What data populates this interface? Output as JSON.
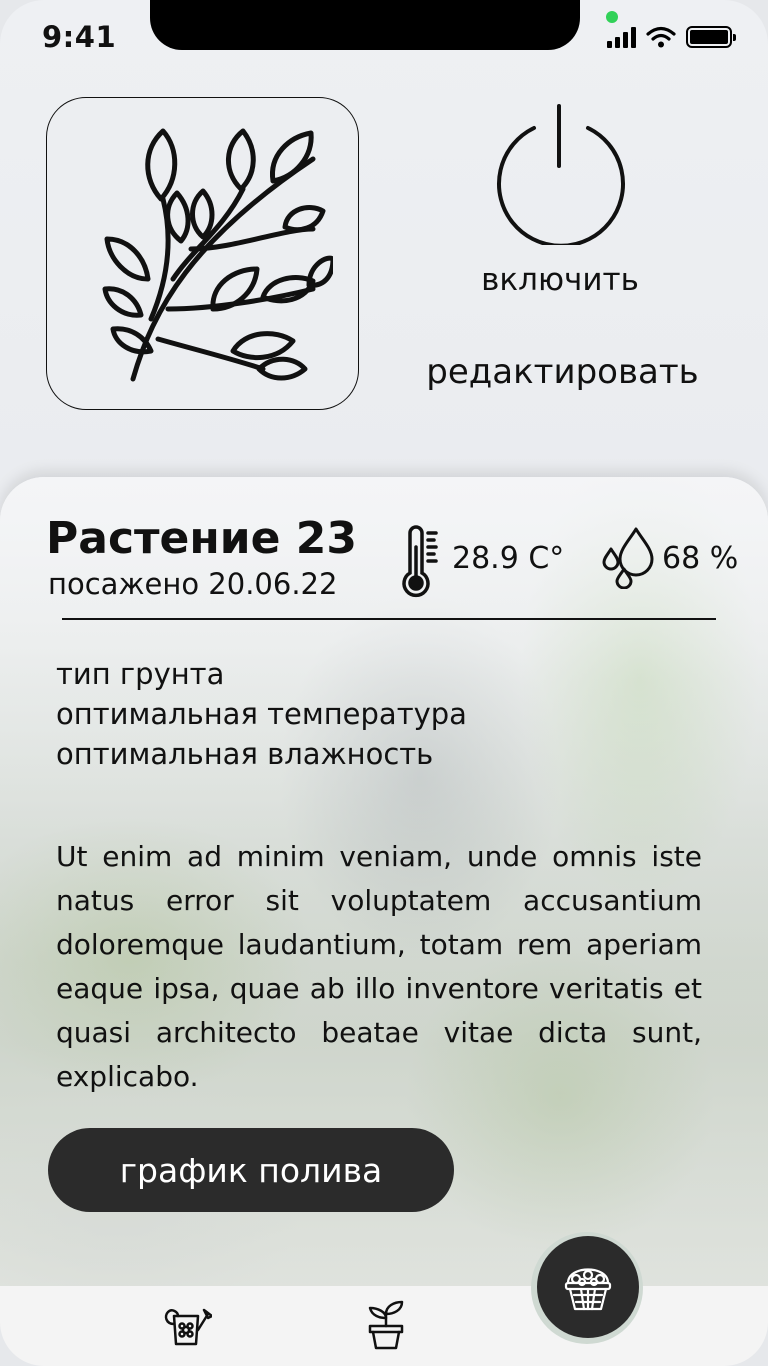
{
  "status_bar": {
    "time": "9:41"
  },
  "controls": {
    "power_label": "включить",
    "edit_label": "редактировать"
  },
  "plant": {
    "title": "Растение 23",
    "planted": "посажено 20.06.22",
    "temperature": "28.9 C°",
    "humidity": "68 %",
    "attributes": [
      "тип грунта",
      "оптимальная температура",
      "оптимальная влажность"
    ],
    "description": "Ut enim ad minim veniam, unde omnis iste natus error sit voluptatem accusantium doloremque laudantium, totam rem aperiam eaque ipsa, quae ab illo inventore veritatis et quasi architecto beatae vitae dicta sunt, explicabo.",
    "schedule_button": "график полива"
  },
  "icons": {
    "plant": "leaf-branch-icon",
    "power": "power-icon",
    "temperature": "thermometer-icon",
    "humidity": "water-drops-icon",
    "tabs": [
      "watering-can-icon",
      "potted-plant-icon",
      "flower-basket-icon"
    ]
  },
  "colors": {
    "button_bg": "#2b2b2b",
    "fab_ring": "#cfd9d2",
    "status_dot": "#31d158"
  }
}
